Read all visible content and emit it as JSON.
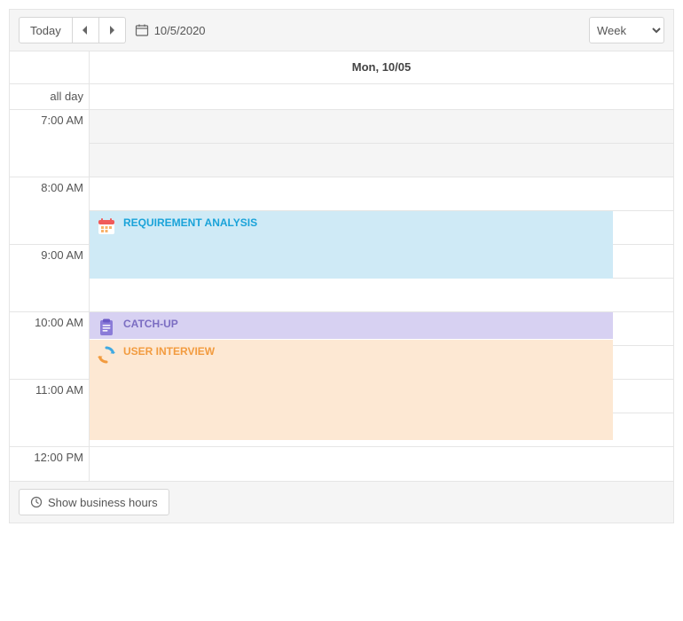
{
  "toolbar": {
    "today_label": "Today",
    "date_label": "10/5/2020",
    "view_select": {
      "selected": "Week"
    }
  },
  "header": {
    "day_label": "Mon, 10/05",
    "allday_label": "all day"
  },
  "time_labels": [
    "7:00 AM",
    "8:00 AM",
    "9:00 AM",
    "10:00 AM",
    "11:00 AM",
    "12:00 PM"
  ],
  "events": [
    {
      "title": "REQUIREMENT ANALYSIS"
    },
    {
      "title": "CATCH-UP"
    },
    {
      "title": "USER INTERVIEW"
    }
  ],
  "footer": {
    "show_business_hours": "Show business hours"
  }
}
